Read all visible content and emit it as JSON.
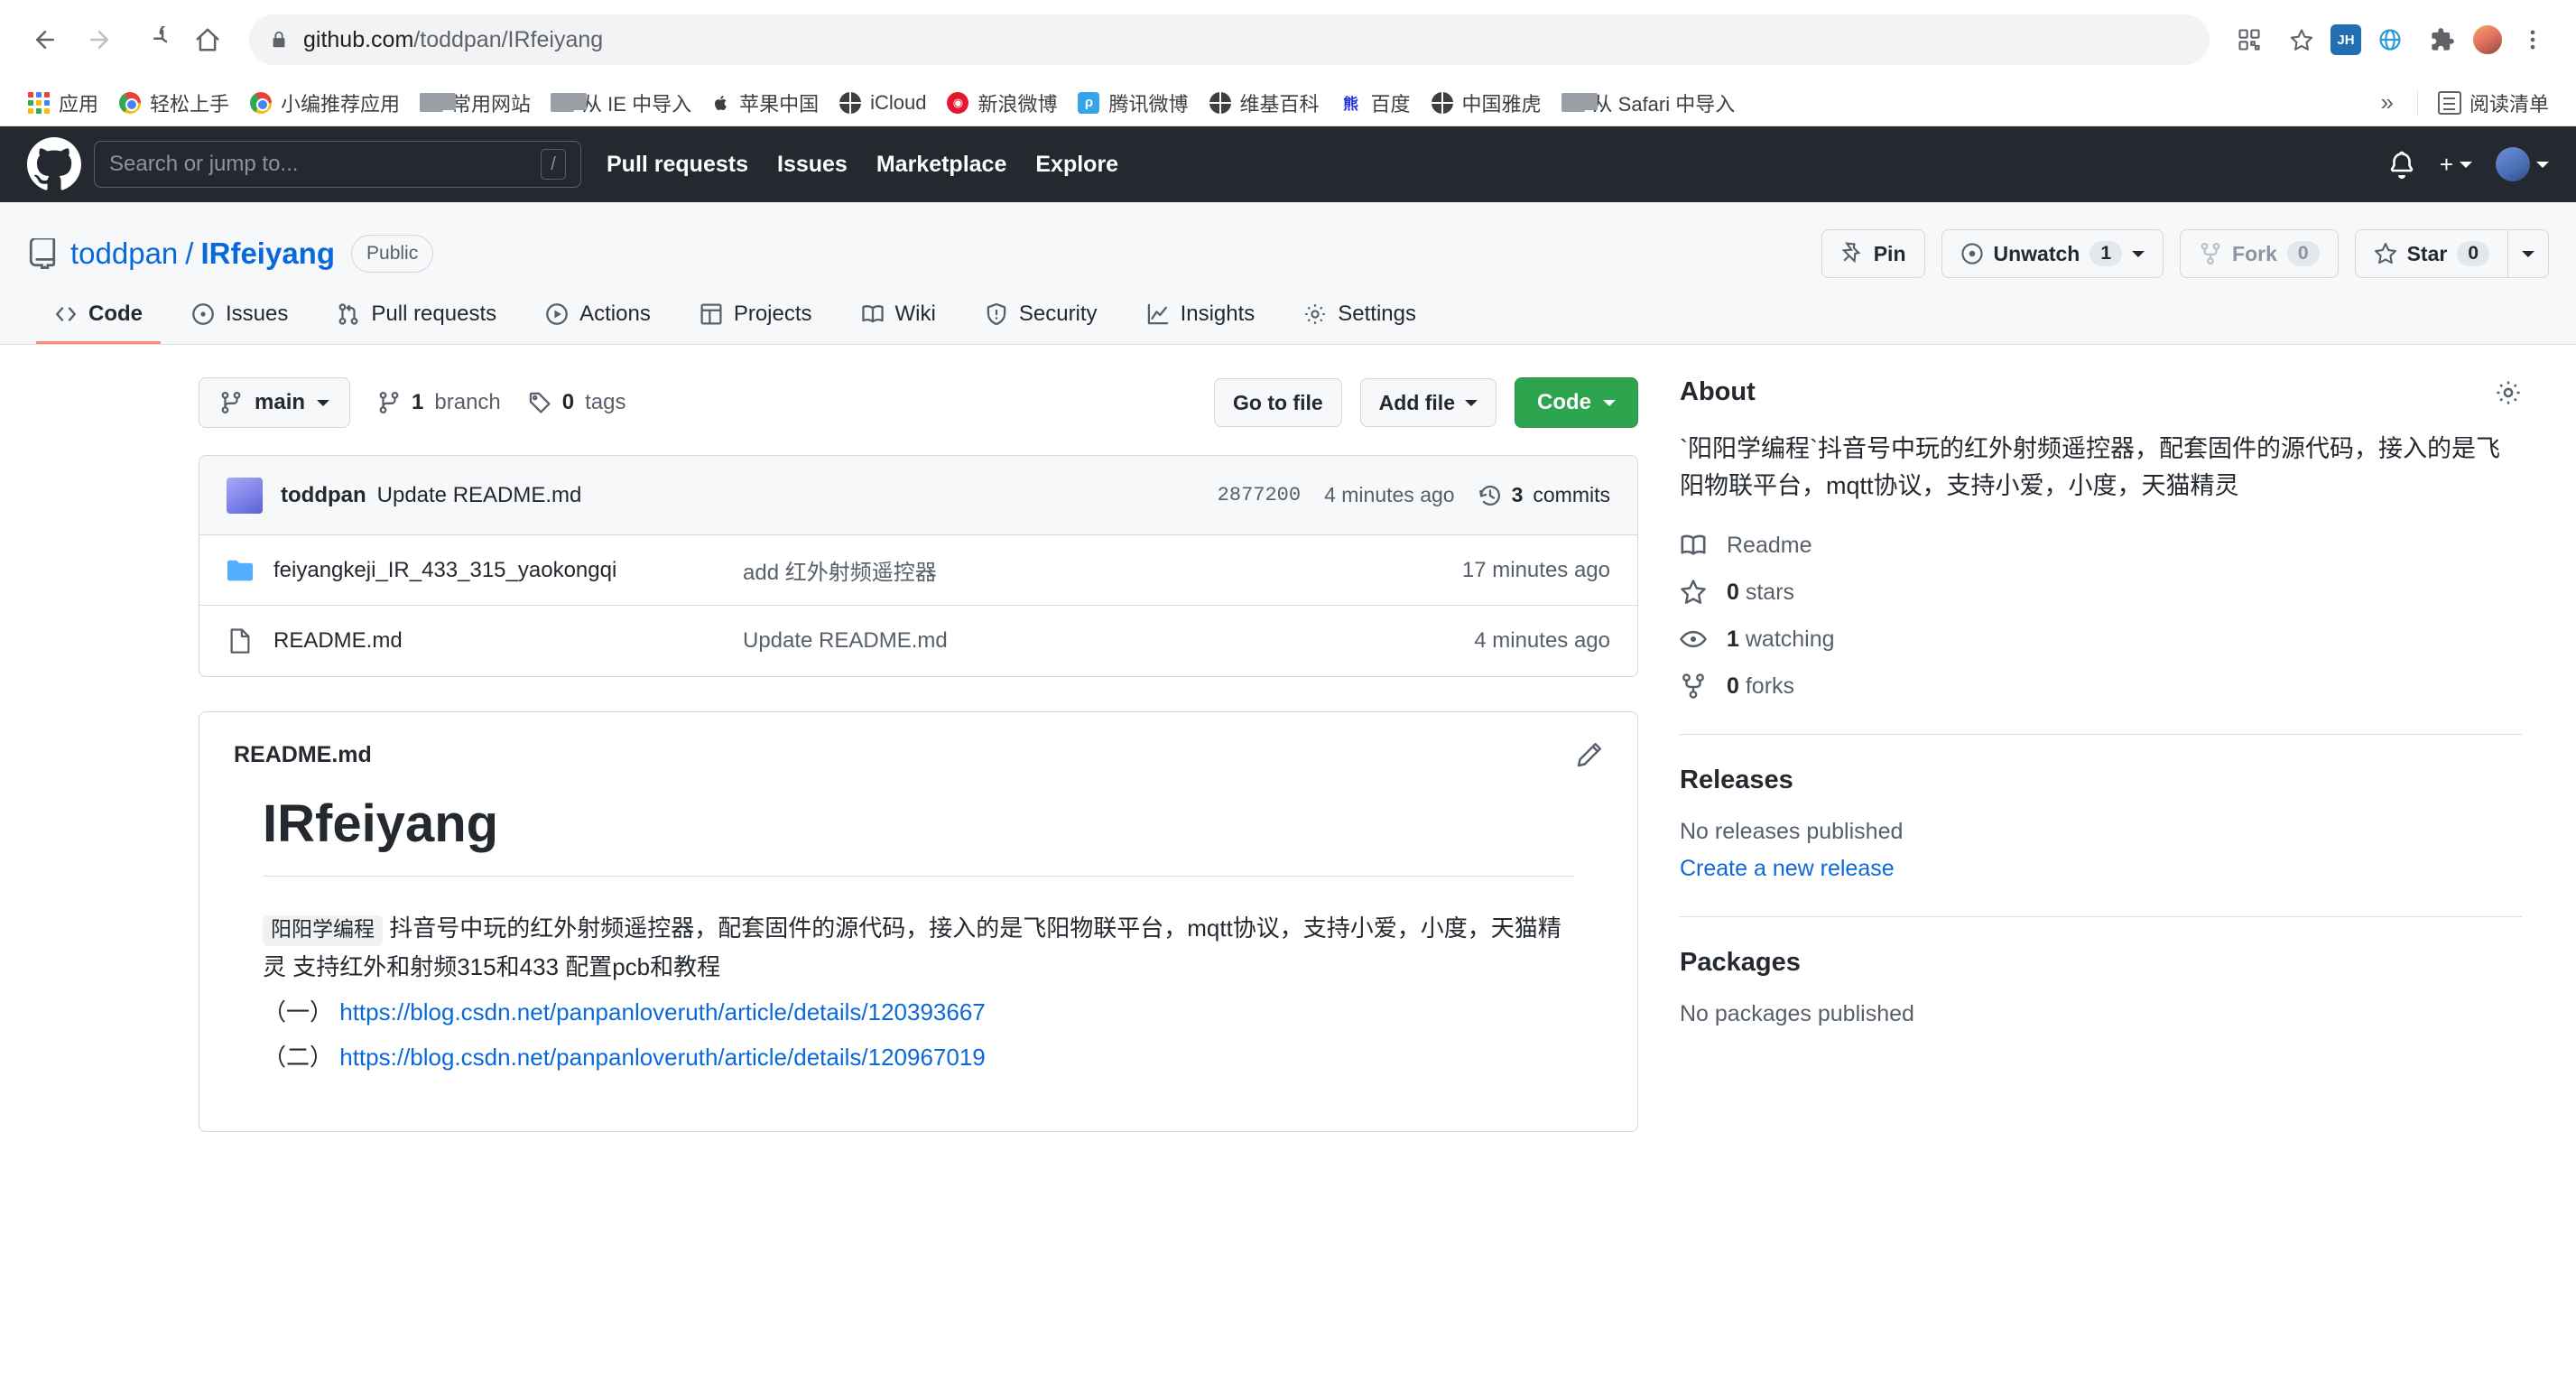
{
  "browser": {
    "url_host": "github.com",
    "url_path": "/toddpan/IRfeiyang",
    "nav": {
      "back": "back-button",
      "forward": "forward-button",
      "reload": "reload-button",
      "home": "home-button"
    },
    "extension_label": "JH",
    "bookmarks": [
      {
        "label": "应用",
        "icon": "apps-grid-icon"
      },
      {
        "label": "轻松上手",
        "icon": "chrome-icon"
      },
      {
        "label": "小编推荐应用",
        "icon": "chrome-icon"
      },
      {
        "label": "常用网站",
        "icon": "folder-icon"
      },
      {
        "label": "从 IE 中导入",
        "icon": "folder-icon"
      },
      {
        "label": "苹果中国",
        "icon": "apple-icon"
      },
      {
        "label": "iCloud",
        "icon": "globe-icon"
      },
      {
        "label": "新浪微博",
        "icon": "weibo-icon"
      },
      {
        "label": "腾讯微博",
        "icon": "tencent-weibo-icon"
      },
      {
        "label": "维基百科",
        "icon": "globe-icon"
      },
      {
        "label": "百度",
        "icon": "baidu-icon"
      },
      {
        "label": "中国雅虎",
        "icon": "globe-icon"
      },
      {
        "label": "从 Safari 中导入",
        "icon": "folder-icon"
      }
    ],
    "overflow": "»",
    "reading_list": "阅读清单"
  },
  "gh_header": {
    "search_placeholder": "Search or jump to...",
    "search_shortcut": "/",
    "nav": [
      {
        "label": "Pull requests"
      },
      {
        "label": "Issues"
      },
      {
        "label": "Marketplace"
      },
      {
        "label": "Explore"
      }
    ]
  },
  "repo": {
    "owner": "toddpan",
    "separator": "/",
    "name": "IRfeiyang",
    "visibility": "Public",
    "actions": {
      "pin": "Pin",
      "watch": "Unwatch",
      "watch_count": "1",
      "fork": "Fork",
      "fork_count": "0",
      "star": "Star",
      "star_count": "0"
    },
    "tabs": [
      {
        "label": "Code",
        "icon": "code-icon",
        "active": true
      },
      {
        "label": "Issues",
        "icon": "issue-opened-icon",
        "active": false
      },
      {
        "label": "Pull requests",
        "icon": "git-pull-request-icon",
        "active": false
      },
      {
        "label": "Actions",
        "icon": "play-icon",
        "active": false
      },
      {
        "label": "Projects",
        "icon": "table-icon",
        "active": false
      },
      {
        "label": "Wiki",
        "icon": "book-icon",
        "active": false
      },
      {
        "label": "Security",
        "icon": "shield-icon",
        "active": false
      },
      {
        "label": "Insights",
        "icon": "graph-icon",
        "active": false
      },
      {
        "label": "Settings",
        "icon": "gear-icon",
        "active": false
      }
    ]
  },
  "file_toolbar": {
    "branch": "main",
    "branch_count": "1",
    "branch_word": "branch",
    "tag_count": "0",
    "tag_word": "tags",
    "go_to_file": "Go to file",
    "add_file": "Add file",
    "code": "Code"
  },
  "commit": {
    "author": "toddpan",
    "message": "Update README.md",
    "sha": "2877200",
    "time": "4 minutes ago",
    "commits_count": "3",
    "commits_label": "commits"
  },
  "files": [
    {
      "name": "feiyangkeji_IR_433_315_yaokongqi",
      "type": "folder",
      "message": "add 红外射频遥控器",
      "time": "17 minutes ago"
    },
    {
      "name": "README.md",
      "type": "file",
      "message": "Update README.md",
      "time": "4 minutes ago"
    }
  ],
  "readme": {
    "header_title": "README.md",
    "heading": "IRfeiyang",
    "badge": "阳阳学编程",
    "paragraph": " 抖音号中玩的红外射频遥控器，配套固件的源代码，接入的是飞阳物联平台，mqtt协议，支持小爱，小度，天猫精灵 支持红外和射频315和433 配置pcb和教程",
    "link1_prefix": "（一）",
    "link1": "https://blog.csdn.net/panpanloveruth/article/details/120393667",
    "link2_prefix": "（二）",
    "link2": "https://blog.csdn.net/panpanloveruth/article/details/120967019"
  },
  "sidebar": {
    "about_title": "About",
    "about_description": "`阳阳学编程`抖音号中玩的红外射频遥控器，配套固件的源代码，接入的是飞阳物联平台，mqtt协议，支持小爱，小度，天猫精灵",
    "stats": [
      {
        "icon": "book-icon",
        "bold": "",
        "label": "Readme"
      },
      {
        "icon": "star-icon",
        "bold": "0",
        "label": "stars"
      },
      {
        "icon": "eye-icon",
        "bold": "1",
        "label": "watching"
      },
      {
        "icon": "fork-icon",
        "bold": "0",
        "label": "forks"
      }
    ],
    "releases_title": "Releases",
    "releases_note": "No releases published",
    "releases_link": "Create a new release",
    "packages_title": "Packages",
    "packages_note": "No packages published"
  },
  "colors": {
    "gh_dark": "#24292f",
    "accent_blue": "#0969da",
    "green": "#2da44e",
    "active_tab": "#fd8c73",
    "border": "#d0d7de"
  }
}
